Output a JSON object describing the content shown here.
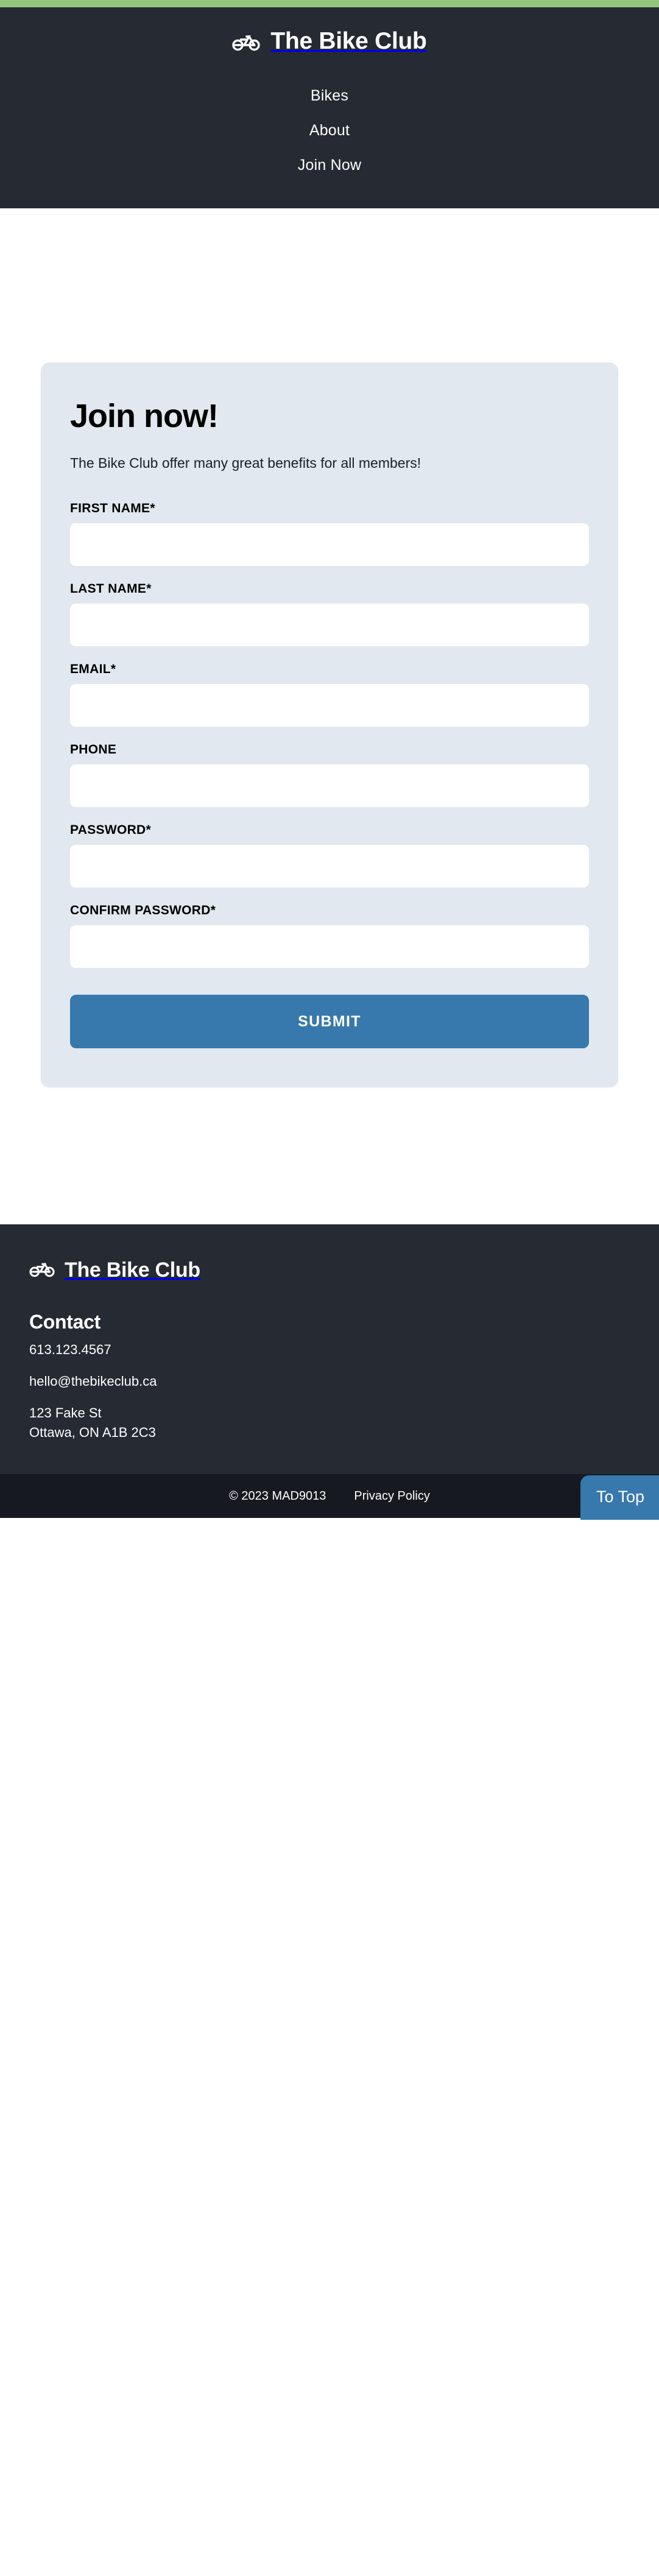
{
  "theme": {
    "accent_green": "#92c47d",
    "header_dark": "#252a33",
    "footer_bottom_dark": "#16191f",
    "card_bg": "#e1e8f0",
    "primary_blue": "#3778ad",
    "text_white": "#ffffff",
    "text_black": "#000000"
  },
  "header": {
    "brand_name": "The Bike Club",
    "brand_icon": "bicycle-icon",
    "nav": [
      {
        "label": "Bikes"
      },
      {
        "label": "About"
      },
      {
        "label": "Join Now"
      }
    ]
  },
  "main": {
    "card": {
      "title": "Join now!",
      "subtitle": "The Bike Club offer many great benefits for all members!",
      "fields": [
        {
          "label": "FIRST NAME*",
          "value": "",
          "placeholder": "",
          "type": "text",
          "name": "first-name"
        },
        {
          "label": "LAST NAME*",
          "value": "",
          "placeholder": "",
          "type": "text",
          "name": "last-name"
        },
        {
          "label": "EMAIL*",
          "value": "",
          "placeholder": "",
          "type": "email",
          "name": "email"
        },
        {
          "label": "PHONE",
          "value": "",
          "placeholder": "",
          "type": "tel",
          "name": "phone"
        },
        {
          "label": "PASSWORD*",
          "value": "",
          "placeholder": "",
          "type": "password",
          "name": "password"
        },
        {
          "label": "CONFIRM PASSWORD*",
          "value": "",
          "placeholder": "",
          "type": "password",
          "name": "confirm-password"
        }
      ],
      "submit_label": "SUBMIT"
    }
  },
  "to_top": {
    "label": "To Top"
  },
  "footer": {
    "brand_name": "The Bike Club",
    "brand_icon": "bicycle-icon",
    "contact_heading": "Contact",
    "phone": "613.123.4567",
    "email": "hello@thebikeclub.ca",
    "address_line1": "123 Fake St",
    "address_line2": "Ottawa, ON A1B 2C3",
    "copyright": "© 2023 MAD9013",
    "privacy_label": "Privacy Policy"
  }
}
